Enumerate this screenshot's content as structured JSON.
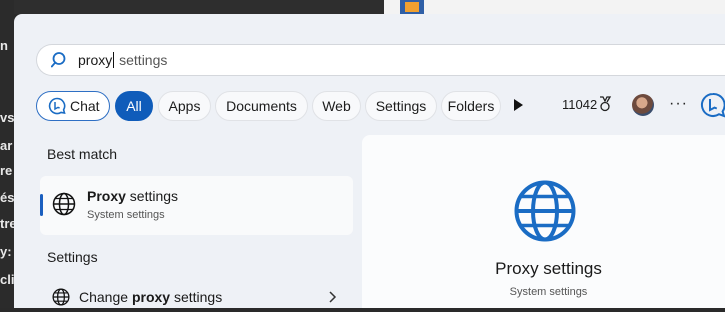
{
  "background": {
    "left_fragments": [
      "n",
      "vs",
      "ar",
      "re",
      "és",
      "tre",
      "y:",
      "cli"
    ]
  },
  "search": {
    "typed": "proxy",
    "suggestion": " settings"
  },
  "filters": {
    "chat": "Chat",
    "all": "All",
    "apps": "Apps",
    "documents": "Documents",
    "web": "Web",
    "settings": "Settings",
    "folders": "Folders",
    "points": "11042"
  },
  "best_match": {
    "heading": "Best match",
    "title_bold": "Proxy",
    "title_rest": " settings",
    "subtitle": "System settings"
  },
  "settings_section": {
    "heading": "Settings",
    "item_prefix": "Change ",
    "item_bold": "proxy",
    "item_suffix": " settings"
  },
  "preview": {
    "title": "Proxy settings",
    "subtitle": "System settings"
  },
  "colors": {
    "accent": "#0f5cba",
    "globe_blue": "#1a6cc4",
    "panel": "#eef1f6"
  }
}
